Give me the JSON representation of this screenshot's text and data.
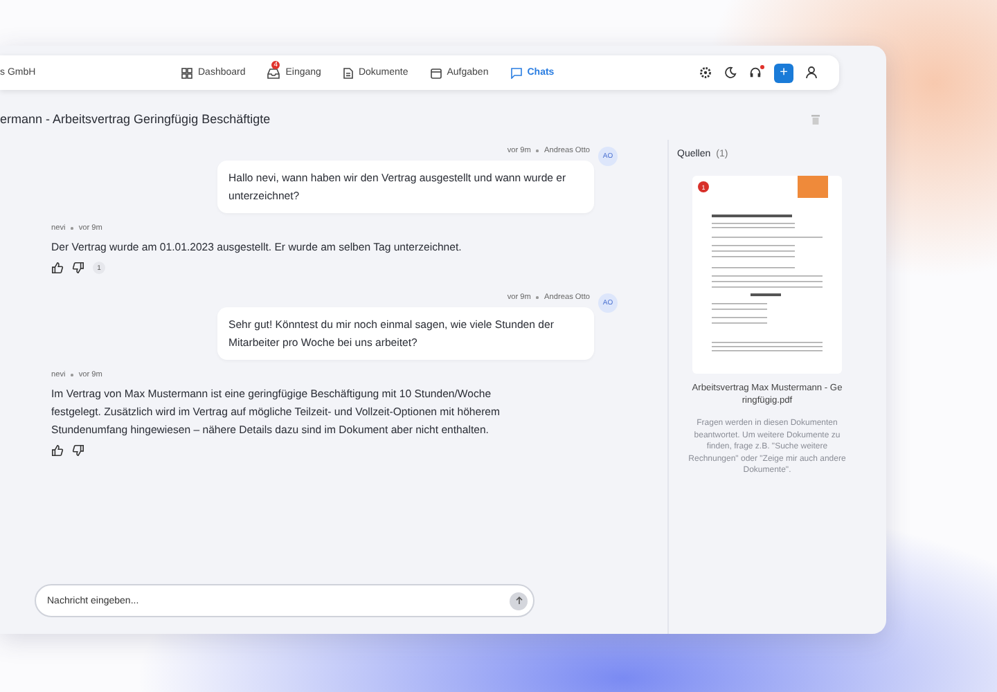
{
  "app": {
    "company": "s GmbH"
  },
  "nav": [
    {
      "label": "Dashboard",
      "selected": false
    },
    {
      "label": "Eingang",
      "selected": false,
      "badge": "4"
    },
    {
      "label": "Dokumente",
      "selected": false
    },
    {
      "label": "Aufgaben",
      "selected": false
    },
    {
      "label": "Chats",
      "selected": true
    }
  ],
  "toolbar": {
    "notification": true,
    "new_button": "+"
  },
  "chat": {
    "title": "ermann - Arbeitsvertrag Geringfügig Beschäftigte",
    "messages": [
      {
        "kind": "user",
        "time": "vor 9m",
        "author": "Andreas Otto",
        "avatar": "AO",
        "text": "Hallo nevi, wann haben wir den Vertrag ausgestellt und wann wurde er unterzeichnet?"
      },
      {
        "kind": "assistant",
        "author": "nevi",
        "time": "vor 9m",
        "text": "Der Vertrag wurde am 01.01.2023 ausgestellt. Er wurde am selben Tag unterzeichnet.",
        "source_count": "1"
      },
      {
        "kind": "user",
        "time": "vor 9m",
        "author": "Andreas Otto",
        "avatar": "AO",
        "text": "Sehr gut! Könntest du mir noch einmal sagen, wie viele Stunden der Mitarbeiter pro Woche bei uns arbeitet?"
      },
      {
        "kind": "assistant",
        "author": "nevi",
        "time": "vor 9m",
        "text": "Im Vertrag von Max Mustermann ist eine geringfügige Beschäftigung mit 10 Stunden/Woche festgelegt. Zusätzlich wird im Vertrag auf mögliche Teilzeit- und Vollzeit-Optionen mit höherem Stundenumfang hingewiesen – nähere Details dazu sind im Dokument aber nicht enthalten."
      }
    ],
    "input": {
      "placeholder": "Nachricht eingeben..."
    }
  },
  "sources": {
    "title": "Quellen",
    "count": "(1)",
    "items": [
      {
        "badge": "1",
        "name": "Arbeitsvertrag Max Mustermann - Geringfügig.pdf"
      }
    ],
    "hint": "Fragen werden in diesen Dokumenten beantwortet. Um weitere Dokumente zu finden, frage z.B. \"Suche weitere Rechnungen\" oder \"Zeige mir auch andere Dokumente\"."
  }
}
